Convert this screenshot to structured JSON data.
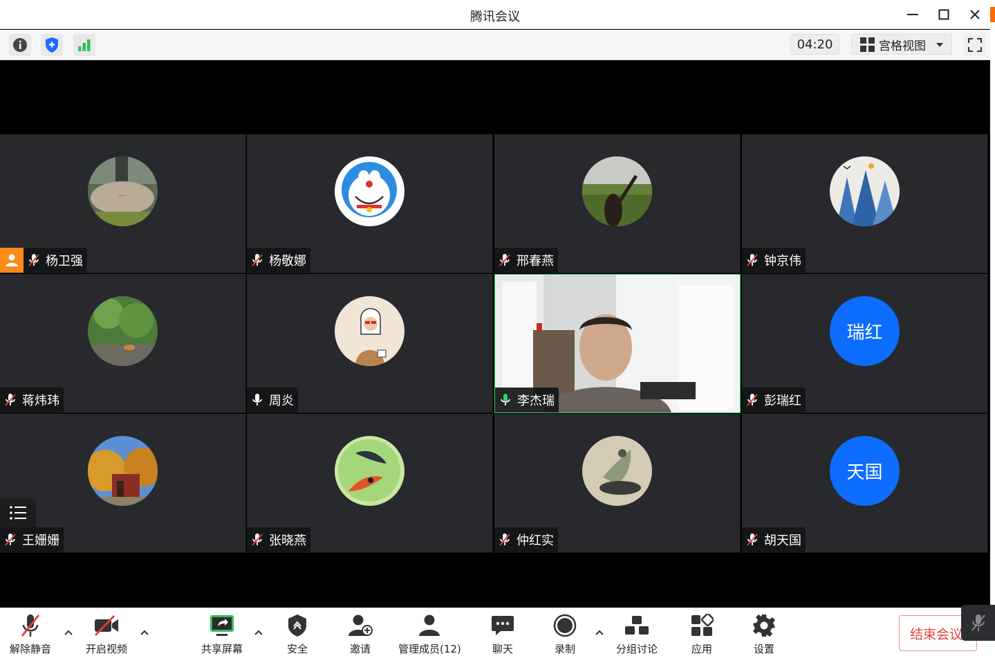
{
  "window": {
    "title": "腾讯会议"
  },
  "infobar": {
    "timer": "04:20",
    "view_mode": "宫格视图"
  },
  "participants": [
    {
      "name": "杨卫强",
      "mic": "muted",
      "host": true,
      "avatar": "photo"
    },
    {
      "name": "杨敬娜",
      "mic": "muted",
      "avatar": "photo"
    },
    {
      "name": "邢春燕",
      "mic": "muted",
      "avatar": "photo"
    },
    {
      "name": "钟京伟",
      "mic": "muted",
      "avatar": "photo"
    },
    {
      "name": "蒋炜玮",
      "mic": "muted",
      "avatar": "photo"
    },
    {
      "name": "周炎",
      "mic": "on",
      "avatar": "photo"
    },
    {
      "name": "李杰瑞",
      "mic": "speaking",
      "avatar": "video"
    },
    {
      "name": "彭瑞红",
      "mic": "muted",
      "avatar": "text",
      "avatar_text": "瑞红"
    },
    {
      "name": "王姗姗",
      "mic": "muted",
      "avatar": "photo"
    },
    {
      "name": "张晓燕",
      "mic": "muted",
      "avatar": "photo"
    },
    {
      "name": "仲红实",
      "mic": "muted",
      "avatar": "photo"
    },
    {
      "name": "胡天国",
      "mic": "muted",
      "avatar": "text",
      "avatar_text": "天国"
    }
  ],
  "toolbar": {
    "unmute": "解除静音",
    "start_video": "开启视频",
    "share_screen": "共享屏幕",
    "security": "安全",
    "invite": "邀请",
    "manage_members": "管理成员(12)",
    "chat": "聊天",
    "record": "录制",
    "breakout": "分组讨论",
    "apps": "应用",
    "settings": "设置",
    "end_meeting": "结束会议"
  },
  "colors": {
    "avatar_blue": "#0c6dff",
    "host_orange": "#ff8a1a",
    "speaking_green": "#2fd26a",
    "end_red": "#e7423c"
  }
}
